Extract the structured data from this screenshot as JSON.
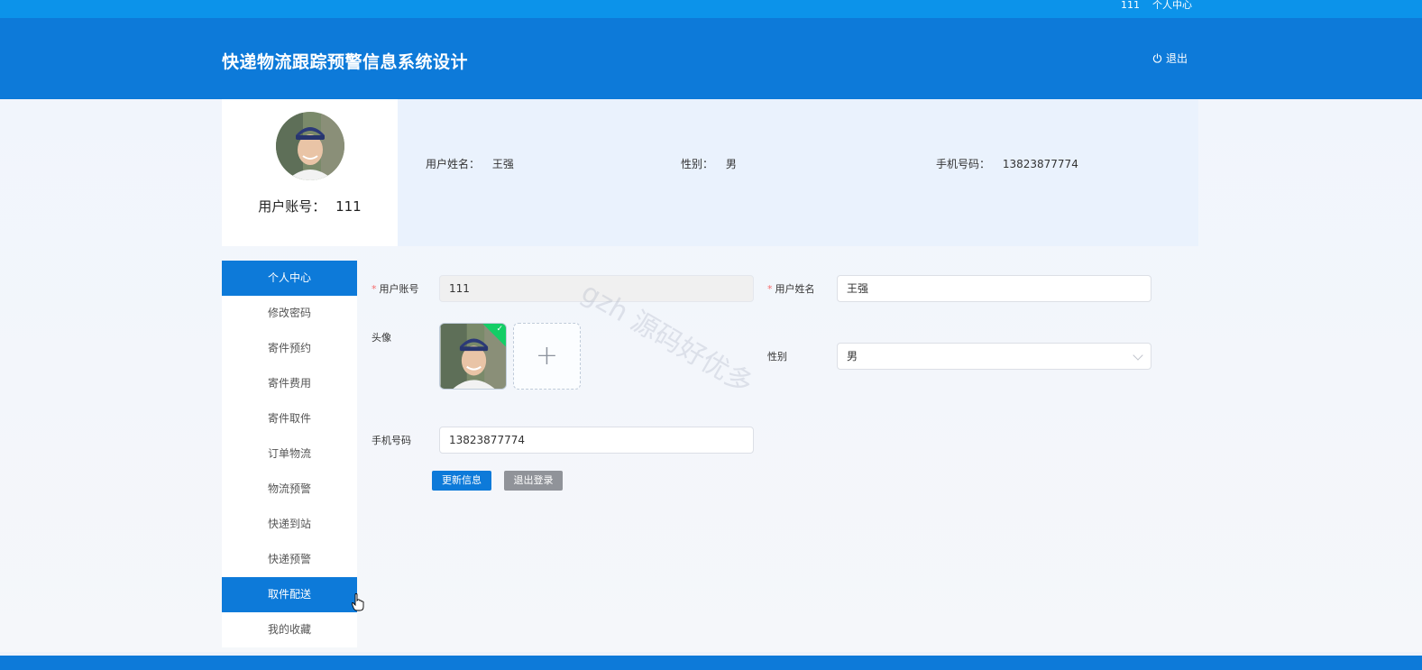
{
  "topbar": {
    "account": "111",
    "personal_center": "个人中心"
  },
  "header": {
    "title": "快递物流跟踪预警信息系统设计",
    "logout_label": "退出",
    "logout_icon": "power-icon"
  },
  "profile": {
    "account_label": "用户账号：",
    "account_value": "111",
    "name_label": "用户姓名：",
    "name_value": "王强",
    "gender_label": "性别：",
    "gender_value": "男",
    "phone_label": "手机号码：",
    "phone_value": "13823877774"
  },
  "sidebar": {
    "items": [
      {
        "label": "个人中心",
        "active": true
      },
      {
        "label": "修改密码",
        "active": false
      },
      {
        "label": "寄件预约",
        "active": false
      },
      {
        "label": "寄件费用",
        "active": false
      },
      {
        "label": "寄件取件",
        "active": false
      },
      {
        "label": "订单物流",
        "active": false
      },
      {
        "label": "物流预警",
        "active": false
      },
      {
        "label": "快递到站",
        "active": false
      },
      {
        "label": "快递预警",
        "active": false
      },
      {
        "label": "取件配送",
        "active": true
      },
      {
        "label": "我的收藏",
        "active": false
      }
    ]
  },
  "form": {
    "account_label": "用户账号",
    "account_value": "111",
    "name_label": "用户姓名",
    "name_value": "王强",
    "avatar_label": "头像",
    "gender_label": "性别",
    "gender_value": "男",
    "phone_label": "手机号码",
    "phone_value": "13823877774",
    "update_button": "更新信息",
    "logout_button": "退出登录"
  },
  "watermark": "gzh 源码好优多",
  "colors": {
    "primary": "#0d7ad9",
    "topbar": "#0c93ea",
    "success": "#13ce66",
    "gray_button": "#909399"
  }
}
